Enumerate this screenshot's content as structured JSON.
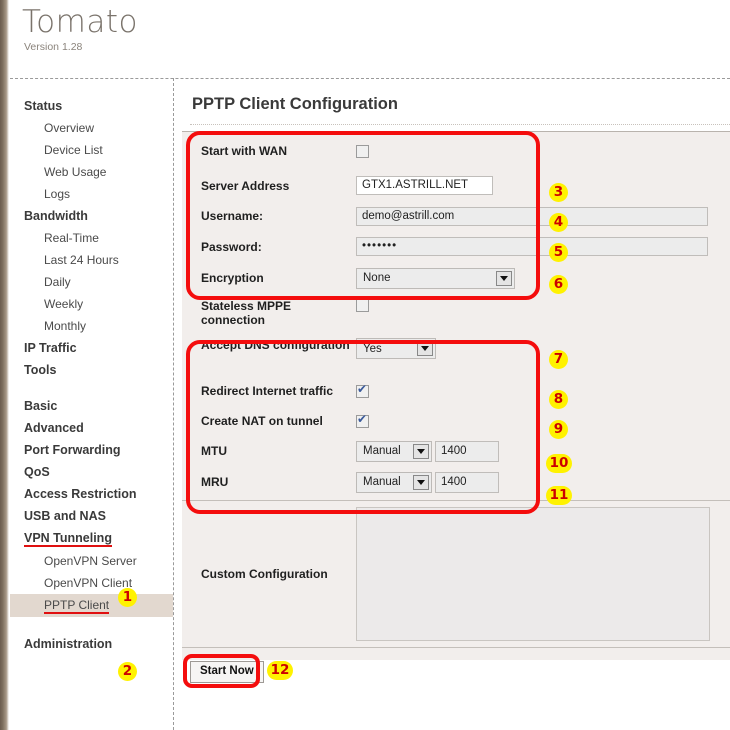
{
  "app": {
    "name": "Tomato",
    "version": "Version 1.28"
  },
  "sidebar": {
    "groups": [
      {
        "head": "Status",
        "items": [
          "Overview",
          "Device List",
          "Web Usage",
          "Logs"
        ]
      },
      {
        "head": "Bandwidth",
        "items": [
          "Real-Time",
          "Last 24 Hours",
          "Daily",
          "Weekly",
          "Monthly"
        ]
      },
      {
        "head": "IP Traffic",
        "items": []
      },
      {
        "head": "Tools",
        "items": []
      }
    ],
    "links": [
      "Basic",
      "Advanced",
      "Port Forwarding",
      "QoS",
      "Access Restriction",
      "USB and NAS"
    ],
    "vpn": {
      "head": "VPN Tunneling",
      "items": [
        "OpenVPN Server",
        "OpenVPN Client",
        "PPTP Client"
      ],
      "active": "PPTP Client"
    },
    "administration": "Administration"
  },
  "main": {
    "title": "PPTP Client Configuration",
    "fields": {
      "start_with_wan": {
        "label": "Start with WAN",
        "checked": false
      },
      "server_address": {
        "label": "Server Address",
        "value": "GTX1.ASTRILL.NET"
      },
      "username": {
        "label": "Username:",
        "value": "demo@astrill.com"
      },
      "password": {
        "label": "Password:",
        "value": "•••••••"
      },
      "encryption": {
        "label": "Encryption",
        "value": "None"
      },
      "stateless_mppe": {
        "label": "Stateless MPPE connection",
        "checked": false
      },
      "accept_dns": {
        "label": "Accept DNS configuration",
        "value": "Yes"
      },
      "redirect_traffic": {
        "label": "Redirect Internet traffic",
        "checked": true
      },
      "create_nat": {
        "label": "Create NAT on tunnel",
        "checked": true
      },
      "mtu": {
        "label": "MTU",
        "mode": "Manual",
        "value": "1400"
      },
      "mru": {
        "label": "MRU",
        "mode": "Manual",
        "value": "1400"
      },
      "custom_configuration": {
        "label": "Custom Configuration",
        "value": ""
      }
    },
    "start_button": "Start Now"
  },
  "annotations": {
    "badges": [
      "1",
      "2",
      "3",
      "4",
      "5",
      "6",
      "7",
      "8",
      "9",
      "10",
      "11",
      "12"
    ],
    "highlight_color": "#f40d0d",
    "badge_bg": "#fff200",
    "badge_fg": "#cc0000"
  }
}
